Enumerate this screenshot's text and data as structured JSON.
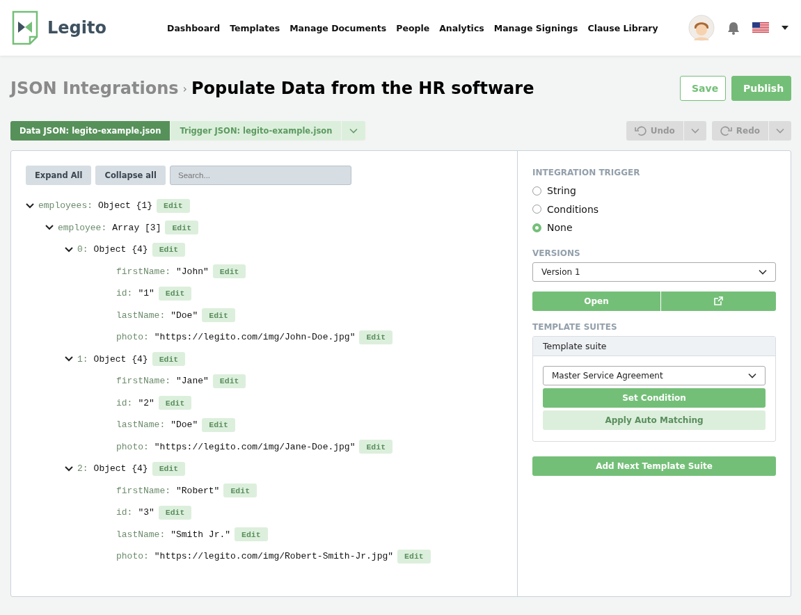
{
  "header": {
    "logo_text": "Legito",
    "nav": [
      {
        "label": "Dashboard"
      },
      {
        "label": "Templates"
      },
      {
        "label": "Manage Documents"
      },
      {
        "label": "People"
      },
      {
        "label": "Analytics"
      },
      {
        "label": "Manage Signings"
      },
      {
        "label": "Clause Library"
      }
    ]
  },
  "breadcrumb": {
    "parent": "JSON Integrations",
    "separator": "›",
    "title": "Populate Data from the HR software"
  },
  "actions": [
    {
      "label": "Save",
      "kind": "outline"
    },
    {
      "label": "Publish",
      "kind": "filled"
    }
  ],
  "json_tabs": [
    {
      "label": "Data JSON: legito-example.json",
      "selected": true
    },
    {
      "label": "Trigger JSON: legito-example.json",
      "selected": false
    }
  ],
  "history": [
    {
      "label": "Undo",
      "kind": "undo",
      "disabled": true
    },
    {
      "label": "Redo",
      "kind": "redo",
      "disabled": true
    }
  ],
  "tree_toolbar": {
    "buttons": [
      "Expand All",
      "Collapse all"
    ],
    "search": {
      "placeholder": "Search..."
    }
  },
  "tree": [
    {
      "key": "employees:",
      "value": "Object {1}",
      "action": "Edit",
      "expanded": true,
      "children": [
        {
          "key": "employee:",
          "value": "Array [3]",
          "action": "Edit",
          "expanded": true,
          "children": [
            {
              "key": "0:",
              "value": "Object {4}",
              "action": "Edit",
              "expanded": true,
              "children": [
                {
                  "key": "firstName:",
                  "value": "\"John\"",
                  "action": "Edit"
                },
                {
                  "key": "id:",
                  "value": "\"1\"",
                  "action": "Edit"
                },
                {
                  "key": "lastName:",
                  "value": "\"Doe\"",
                  "action": "Edit"
                },
                {
                  "key": "photo:",
                  "value": "\"https://legito.com/img/John-Doe.jpg\"",
                  "action": "Edit"
                }
              ]
            },
            {
              "key": "1:",
              "value": "Object {4}",
              "action": "Edit",
              "expanded": true,
              "children": [
                {
                  "key": "firstName:",
                  "value": "\"Jane\"",
                  "action": "Edit"
                },
                {
                  "key": "id:",
                  "value": "\"2\"",
                  "action": "Edit"
                },
                {
                  "key": "lastName:",
                  "value": "\"Doe\"",
                  "action": "Edit"
                },
                {
                  "key": "photo:",
                  "value": "\"https://legito.com/img/Jane-Doe.jpg\"",
                  "action": "Edit"
                }
              ]
            },
            {
              "key": "2:",
              "value": "Object {4}",
              "action": "Edit",
              "expanded": true,
              "children": [
                {
                  "key": "firstName:",
                  "value": "\"Robert\"",
                  "action": "Edit"
                },
                {
                  "key": "id:",
                  "value": "\"3\"",
                  "action": "Edit"
                },
                {
                  "key": "lastName:",
                  "value": "\"Smith Jr.\"",
                  "action": "Edit"
                },
                {
                  "key": "photo:",
                  "value": "\"https://legito.com/img/Robert-Smith-Jr.jpg\"",
                  "action": "Edit"
                }
              ]
            }
          ]
        }
      ]
    }
  ],
  "sidebar": {
    "trigger_heading": "INTEGRATION TRIGGER",
    "triggers": [
      {
        "label": "String",
        "selected": false
      },
      {
        "label": "Conditions",
        "selected": false
      },
      {
        "label": "None",
        "selected": true
      }
    ],
    "versions_heading": "VERSIONS",
    "version": "Version 1",
    "open_button": "Open",
    "suites_heading": "TEMPLATE SUITES",
    "suite": {
      "title": "Template suite",
      "template": "Master Service Agreement",
      "set_condition": "Set Condition",
      "auto_matching": "Apply Auto Matching"
    },
    "add_suite": "Add Next Template Suite"
  }
}
